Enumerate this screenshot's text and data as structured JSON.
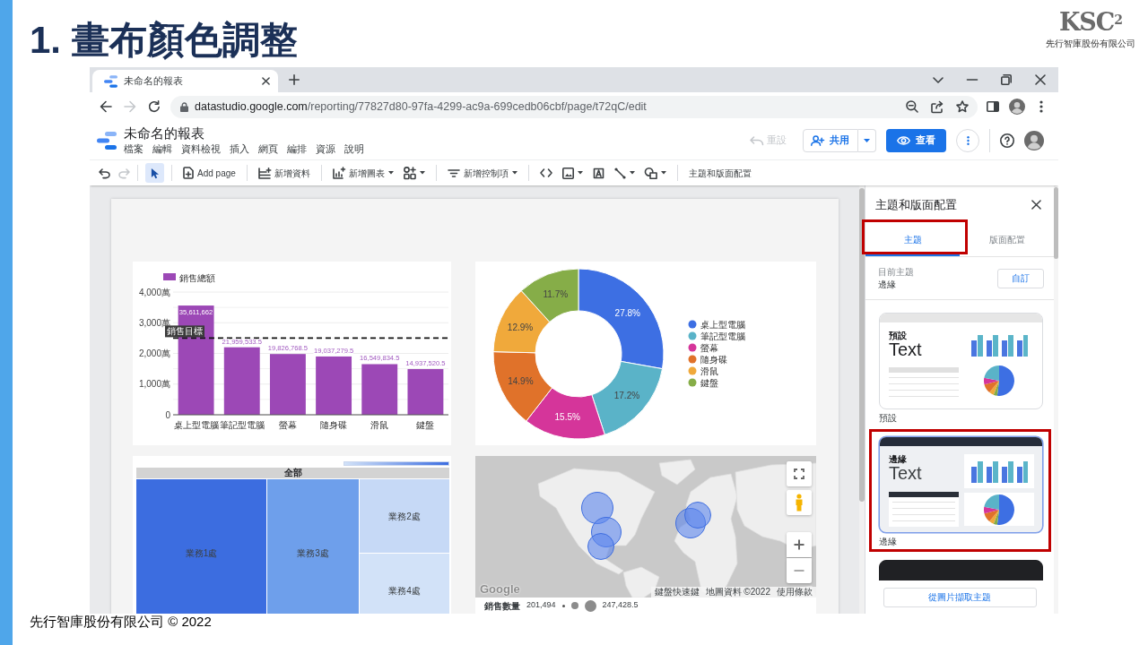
{
  "slide": {
    "title": "1. 畫布顏色調整",
    "logo": "KSC$^{2}$",
    "company": "先行智庫股份有限公司",
    "footer": "先行智庫股份有限公司 © 2022"
  },
  "browser": {
    "tab_title": "未命名的報表",
    "forward": {
      "disabled": true
    },
    "url_host": "datastudio.google.com",
    "url_path": "/reporting/77827d80-97fa-4299-ac9a-699cedb06cbf/page/t72qC/edit"
  },
  "report": {
    "title": "未命名的報表",
    "menu": [
      "檔案",
      "編輯",
      "資料檢視",
      "插入",
      "網頁",
      "編排",
      "資源",
      "說明"
    ],
    "reset": {
      "label": "重設",
      "disabled": true
    },
    "share": "共用",
    "view": "查看"
  },
  "toolbar": {
    "undo": {
      "disabled": false
    },
    "redo": {
      "disabled": true
    },
    "pointer": {
      "selected": true
    },
    "add_page": "Add page",
    "add_data": "新增資料",
    "add_chart": "新增圖表",
    "add_control": "新增控制項",
    "theme_and_layout": "主題和版面配置"
  },
  "canvas": {
    "bar_chart": {
      "chart_data": {
        "type": "bar",
        "categories": [
          "桌上型電腦",
          "筆記型電腦",
          "螢幕",
          "隨身碟",
          "滑鼠",
          "鍵盤"
        ],
        "series": [
          {
            "name": "銷售總額",
            "color": "#9c48b6",
            "values": [
              3560,
              2200,
              1980,
              1900,
              1650,
              1490
            ]
          }
        ],
        "ylim": [
          0,
          4000
        ],
        "yticks": [
          {
            "value": 0,
            "label": "0"
          },
          {
            "value": 1000,
            "label": "1,000萬"
          },
          {
            "value": 2000,
            "label": "2,000萬"
          },
          {
            "value": 3000,
            "label": "3,000萬"
          },
          {
            "value": 4000,
            "label": "4,000萬"
          }
        ],
        "grid": true,
        "value_labels": [
          "35,611,662",
          "21,959,533.5",
          "19,826,768.5",
          "19,037,279.5",
          "16,549,834.5",
          "14,937,520.5"
        ],
        "ref_lines": [
          {
            "axis": "y",
            "value": 2500,
            "label": "銷售目標",
            "color": "#111111"
          }
        ]
      }
    },
    "donut_chart": {
      "legend": [
        {
          "label": "桌上型電腦",
          "color": "#3d6fe3"
        },
        {
          "label": "筆記型電腦",
          "color": "#5ab3c8"
        },
        {
          "label": "螢幕",
          "color": "#d5359a"
        },
        {
          "label": "隨身碟",
          "color": "#e0722a"
        },
        {
          "label": "滑鼠",
          "color": "#f0a93b"
        },
        {
          "label": "鍵盤",
          "color": "#86ad48"
        }
      ],
      "chart_data": {
        "type": "donut",
        "values": [
          27.8,
          17.2,
          15.5,
          14.9,
          12.9,
          11.7
        ],
        "value_labels": [
          "27.8%",
          "17.2%",
          "15.5%",
          "14.9%",
          "12.9%",
          "11.7%"
        ]
      }
    },
    "treemap": {
      "header": "全部",
      "tiles": [
        {
          "label": "業務1處",
          "color": "#3c6de0"
        },
        {
          "label": "業務3處",
          "color": "#6e9feb"
        },
        {
          "label": "業務2處",
          "color": "#c6d9f6"
        },
        {
          "label": "業務4處",
          "color": "#d2e2f8"
        }
      ]
    },
    "map": {
      "logo": "Google",
      "attribution": [
        "鍵盤快速鍵",
        "地圖資料 ©2022",
        "使用條款"
      ],
      "size_legend": {
        "title": "銷售數量",
        "min": "201,494",
        "max": "247,428.5"
      }
    }
  },
  "theme_panel": {
    "title": "主題和版面配置",
    "tabs": [
      {
        "label": "主題",
        "selected": true,
        "highlighted": true
      },
      {
        "label": "版面配置",
        "selected": false,
        "highlighted": false
      }
    ],
    "current_theme": {
      "label": "目前主題",
      "value": "邊緣"
    },
    "customize": "自訂",
    "themes": [
      {
        "kind": "default",
        "name": "預設",
        "preview_title": "預設",
        "preview_text": "Text",
        "selected": false,
        "highlighted": false
      },
      {
        "kind": "edge",
        "name": "邊緣",
        "preview_title": "邊緣",
        "preview_text": "Text",
        "selected": true,
        "highlighted": true
      },
      {
        "kind": "dark",
        "selected": false,
        "highlighted": false
      }
    ],
    "extract_button": "從圖片擷取主題"
  }
}
